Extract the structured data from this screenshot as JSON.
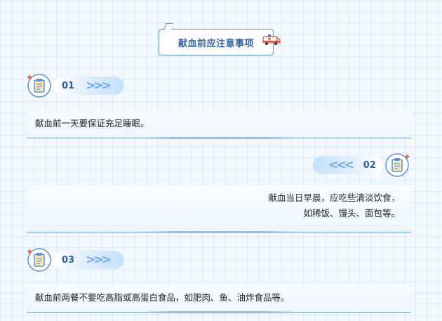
{
  "title": "献血前应注意事项",
  "steps": [
    {
      "num": "01",
      "arrows": ">>>",
      "lines": [
        "献血前一天要保证充足睡眠。"
      ]
    },
    {
      "num": "02",
      "arrows": "<<<",
      "lines": [
        "献血当日早晨，应吃些清淡饮食，",
        "如稀饭、馒头、面包等。"
      ]
    },
    {
      "num": "03",
      "arrows": ">>>",
      "lines": [
        "献血前两餐不要吃高脂或高蛋白食品，如肥肉、鱼、油炸食品等。"
      ]
    }
  ],
  "icons": {
    "title_icon": "ambulance-icon",
    "step_icon": "clipboard-icon"
  },
  "colors": {
    "accent": "#2f63a8",
    "arrow": "#69aaf2",
    "cross": "#f0634f"
  }
}
